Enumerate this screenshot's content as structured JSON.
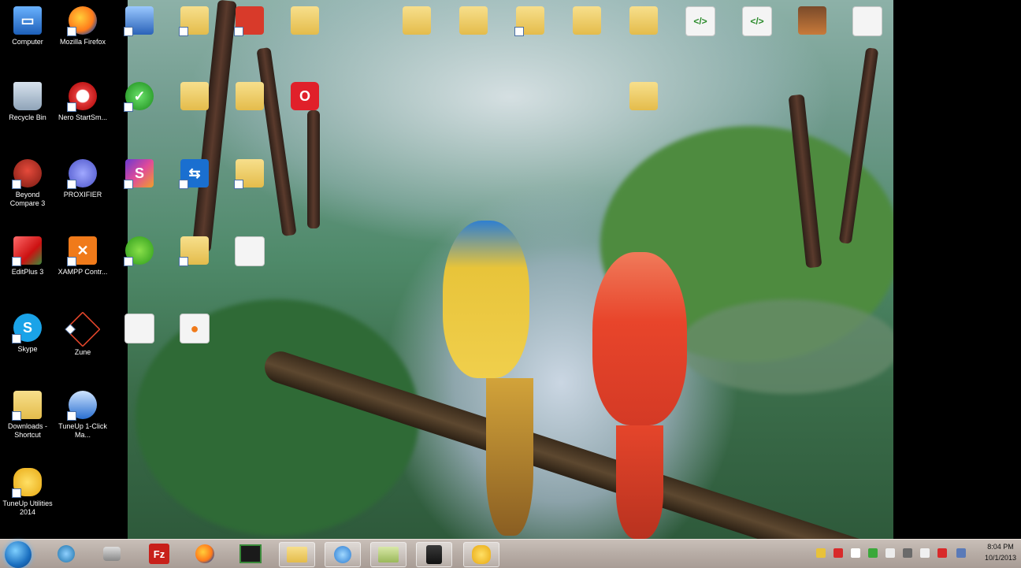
{
  "desktop": {
    "icons_left": [
      {
        "label": "Computer",
        "icon": "computer-icon"
      },
      {
        "label": "Mozilla Firefox",
        "icon": "firefox-icon"
      },
      {
        "label": "Recycle Bin",
        "icon": "recycle-bin-icon"
      },
      {
        "label": "Nero StartSm...",
        "icon": "nero-icon"
      },
      {
        "label": "Beyond Compare 3",
        "icon": "beyond-compare-icon"
      },
      {
        "label": "PROXIFIER",
        "icon": "proxifier-icon"
      },
      {
        "label": "EditPlus 3",
        "icon": "editplus-icon"
      },
      {
        "label": "XAMPP Contr...",
        "icon": "xampp-icon"
      },
      {
        "label": "Skype",
        "icon": "skype-icon"
      },
      {
        "label": "Zune",
        "icon": "zune-icon"
      },
      {
        "label": "Downloads - Shortcut",
        "icon": "downloads-folder-icon"
      },
      {
        "label": "TuneUp 1-Click Ma...",
        "icon": "tuneup-icon"
      },
      {
        "label": "TuneUp Utilities 2014",
        "icon": "tuneup-utilities-icon"
      }
    ]
  },
  "taskbar": {
    "items": [
      {
        "name": "start-button",
        "icon": "windows-orb-icon"
      },
      {
        "name": "explorer",
        "icon": "globe-icon"
      },
      {
        "name": "media",
        "icon": "media-icon"
      },
      {
        "name": "filezilla",
        "icon": "filezilla-icon",
        "text": "Fz"
      },
      {
        "name": "firefox",
        "icon": "firefox-icon"
      },
      {
        "name": "terminal",
        "icon": "terminal-icon"
      },
      {
        "name": "folder1",
        "icon": "folder-icon"
      },
      {
        "name": "ie",
        "icon": "ie-icon"
      },
      {
        "name": "folder2",
        "icon": "folder-icon"
      },
      {
        "name": "app",
        "icon": "app-icon"
      },
      {
        "name": "tuneup",
        "icon": "tuneup-icon"
      }
    ],
    "clock": {
      "time": "8:04 PM",
      "date": "10/1/2013"
    }
  }
}
